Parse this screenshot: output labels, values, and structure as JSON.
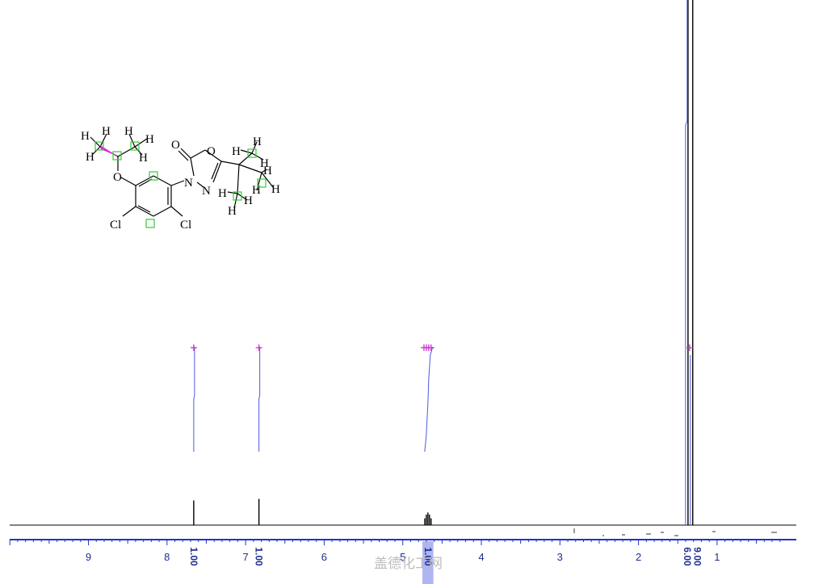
{
  "chart_data": {
    "type": "line",
    "x_axis": {
      "reversed": true,
      "range": [
        0.2,
        10.2
      ],
      "major_ticks": [
        9,
        8,
        7,
        6,
        5,
        4,
        3,
        2,
        1
      ],
      "tick_labels": [
        "9",
        "8",
        "7",
        "6",
        "5",
        "4",
        "3",
        "2",
        "1"
      ],
      "minor_step": 0.1
    },
    "series": [
      {
        "peaks": [
          {
            "shift": 7.66,
            "height": 0.047
          },
          {
            "shift": 6.83,
            "height": 0.05
          },
          {
            "shift": 4.72,
            "height": 0.013
          },
          {
            "shift": 4.7,
            "height": 0.02
          },
          {
            "shift": 4.68,
            "height": 0.024
          },
          {
            "shift": 4.66,
            "height": 0.02
          },
          {
            "shift": 4.64,
            "height": 0.013
          },
          {
            "shift": 1.37,
            "height": 1.0
          },
          {
            "shift": 1.31,
            "height": 1.0
          }
        ]
      }
    ],
    "integrals": [
      {
        "shift": 7.66,
        "label": "1.00"
      },
      {
        "shift": 6.83,
        "label": "1.00"
      },
      {
        "shift": 4.68,
        "label": "1.00"
      },
      {
        "shift": 1.34,
        "label": "6.00"
      },
      {
        "shift": 1.3,
        "label": "9.00"
      }
    ]
  },
  "molecule": {
    "atoms": {
      "O_ether": "O",
      "Cl_left": "Cl",
      "Cl_right": "Cl",
      "N3": "N",
      "N4": "N",
      "O_carbonyl": "O",
      "O_ring": "O"
    },
    "hydrogens": [
      "H",
      "H",
      "H",
      "H",
      "H",
      "H",
      "H",
      "H",
      "H",
      "H",
      "H",
      "H",
      "H",
      "H",
      "H"
    ]
  },
  "watermark": "盖德化工网",
  "colors": {
    "spectrum": "#000000",
    "axis": "#2233cc",
    "integral": "#4a5be0",
    "peak_marker": "#cc33cc",
    "highlight": "#33cc33",
    "wedge": "#e020e0",
    "integral_band": "#9aa3f0"
  }
}
